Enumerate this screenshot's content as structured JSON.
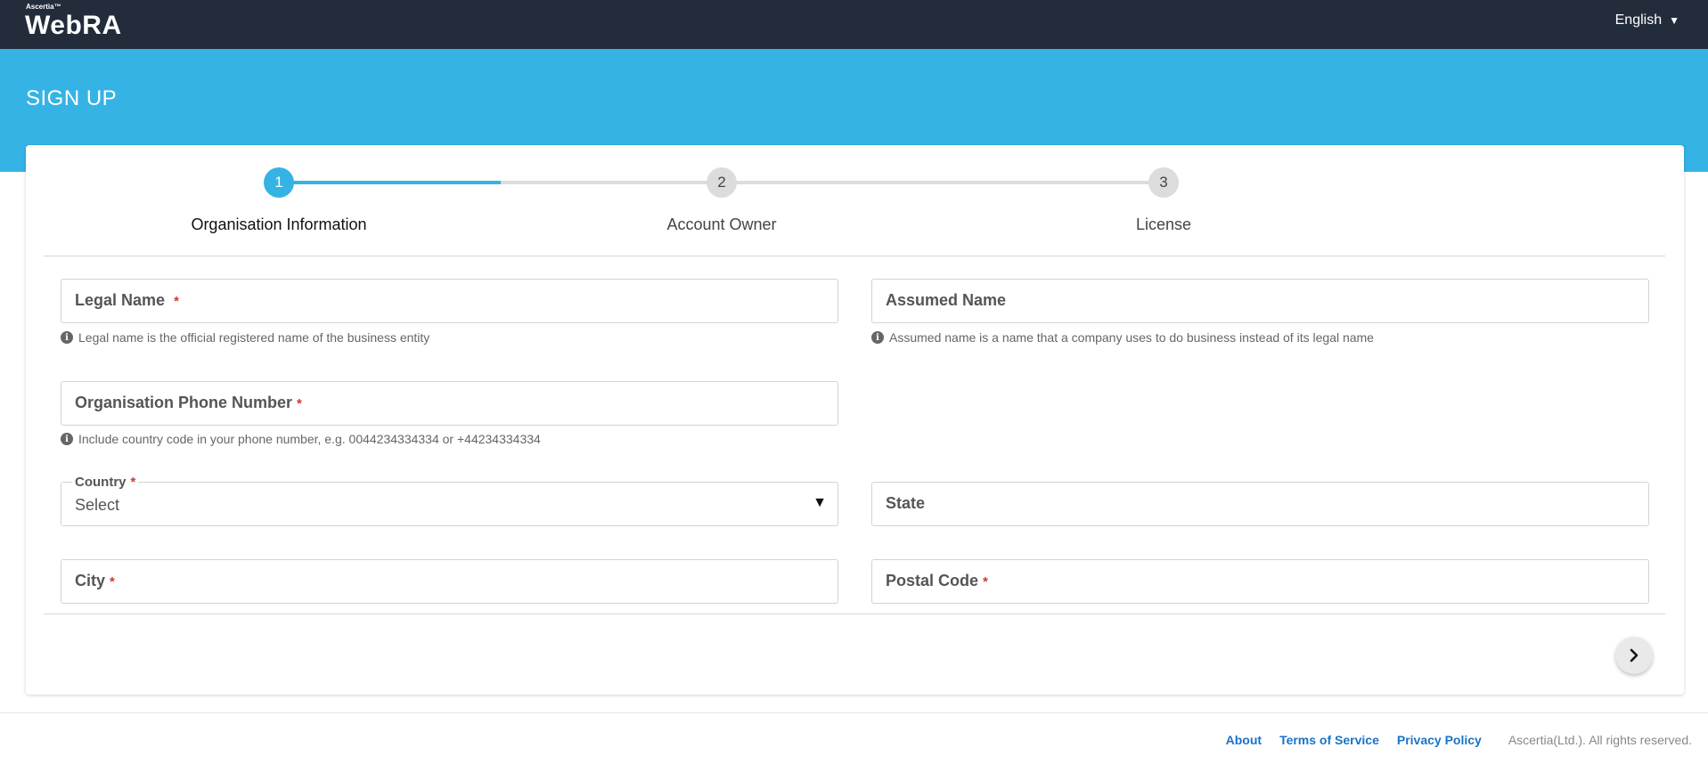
{
  "header": {
    "brand_small": "Ascertia™",
    "brand": "WebRA",
    "language": "English"
  },
  "page": {
    "title": "SIGN UP"
  },
  "stepper": {
    "progress": 0.5,
    "steps": [
      {
        "number": "1",
        "label": "Organisation Information",
        "active": true
      },
      {
        "number": "2",
        "label": "Account Owner",
        "active": false
      },
      {
        "number": "3",
        "label": "License",
        "active": false
      }
    ]
  },
  "form": {
    "legal_name": {
      "label": "Legal Name",
      "required": "*",
      "hint": "Legal name is the official registered name of the business entity"
    },
    "assumed_name": {
      "label": "Assumed Name",
      "hint": "Assumed name is a name that a company uses to do business instead of its legal name"
    },
    "phone": {
      "label": "Organisation Phone Number",
      "required": "*",
      "hint": "Include country code in your phone number, e.g. 0044234334334 or +44234334334"
    },
    "country": {
      "label": "Country",
      "required": "*",
      "value": "Select"
    },
    "state": {
      "label": "State"
    },
    "city": {
      "label": "City",
      "required": "*"
    },
    "postal_code": {
      "label": "Postal Code",
      "required": "*"
    }
  },
  "icons": {
    "info": "info-icon",
    "next": "chevron-right-icon",
    "dropdown": "caret-down-icon"
  },
  "footer": {
    "links": [
      "About",
      "Terms of Service",
      "Privacy Policy"
    ],
    "copyright": "Ascertia(Ltd.). All rights reserved."
  },
  "colors": {
    "topbar": "#232c3b",
    "accent": "#35b3e5",
    "required": "#d9342b",
    "link": "#1a73c8"
  }
}
